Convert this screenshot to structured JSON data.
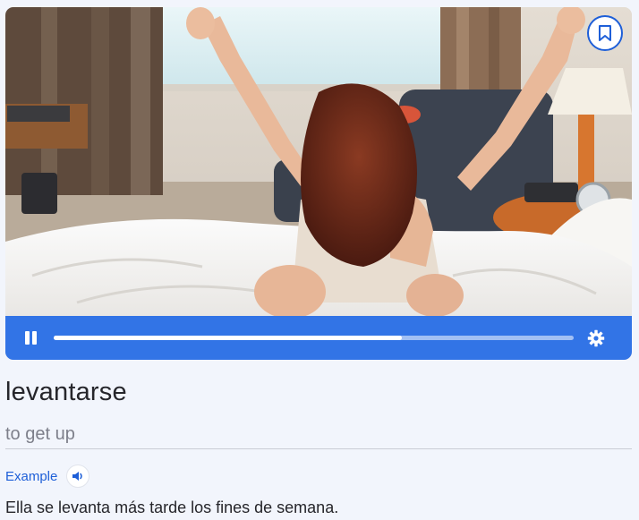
{
  "media": {
    "image_alt": "Woman stretching her arms up while sitting on a hotel bed",
    "bookmark_icon": "bookmark-icon",
    "player": {
      "pause_icon": "pause-icon",
      "settings_icon": "gear-icon",
      "progress": 0.67
    }
  },
  "entry": {
    "word": "levantarse",
    "translation": "to get up",
    "example_label": "Example",
    "audio_icon": "speaker-icon",
    "example_sentence": "Ella se levanta más tarde los fines de semana."
  },
  "colors": {
    "accent": "#3274e6",
    "link": "#1e5fd8",
    "background": "#f2f5fc",
    "muted_text": "#7d7f8a"
  }
}
